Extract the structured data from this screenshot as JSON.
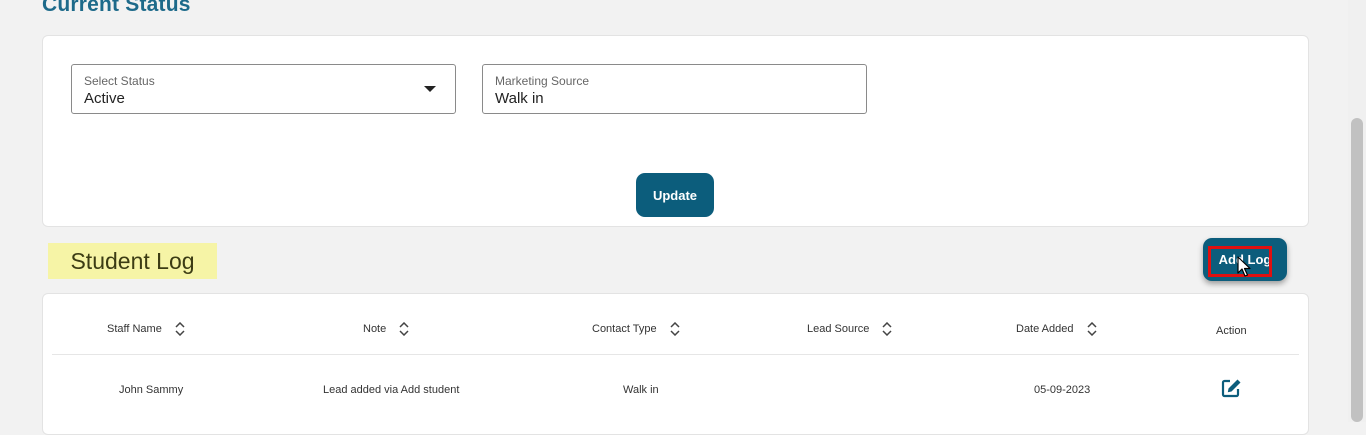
{
  "page": {
    "title": "Current Status"
  },
  "status_form": {
    "status_label": "Select Status",
    "status_value": "Active",
    "source_label": "Marketing Source",
    "source_value": "Walk in",
    "update_label": "Update"
  },
  "log": {
    "title": "Student Log",
    "add_log_label": "Add Log"
  },
  "table": {
    "columns": [
      "Staff Name",
      "Note",
      "Contact Type",
      "Lead Source",
      "Date Added",
      "Action"
    ],
    "rows": [
      {
        "staff_name": "John Sammy",
        "note": "Lead added via Add student",
        "contact_type": "Walk in",
        "lead_source": "",
        "date_added": "05-09-2023"
      }
    ]
  },
  "colors": {
    "primary": "#0c5d7c",
    "heading": "#1d6a8a",
    "highlight": "#f6f4a6",
    "annotation": "#e01010"
  }
}
